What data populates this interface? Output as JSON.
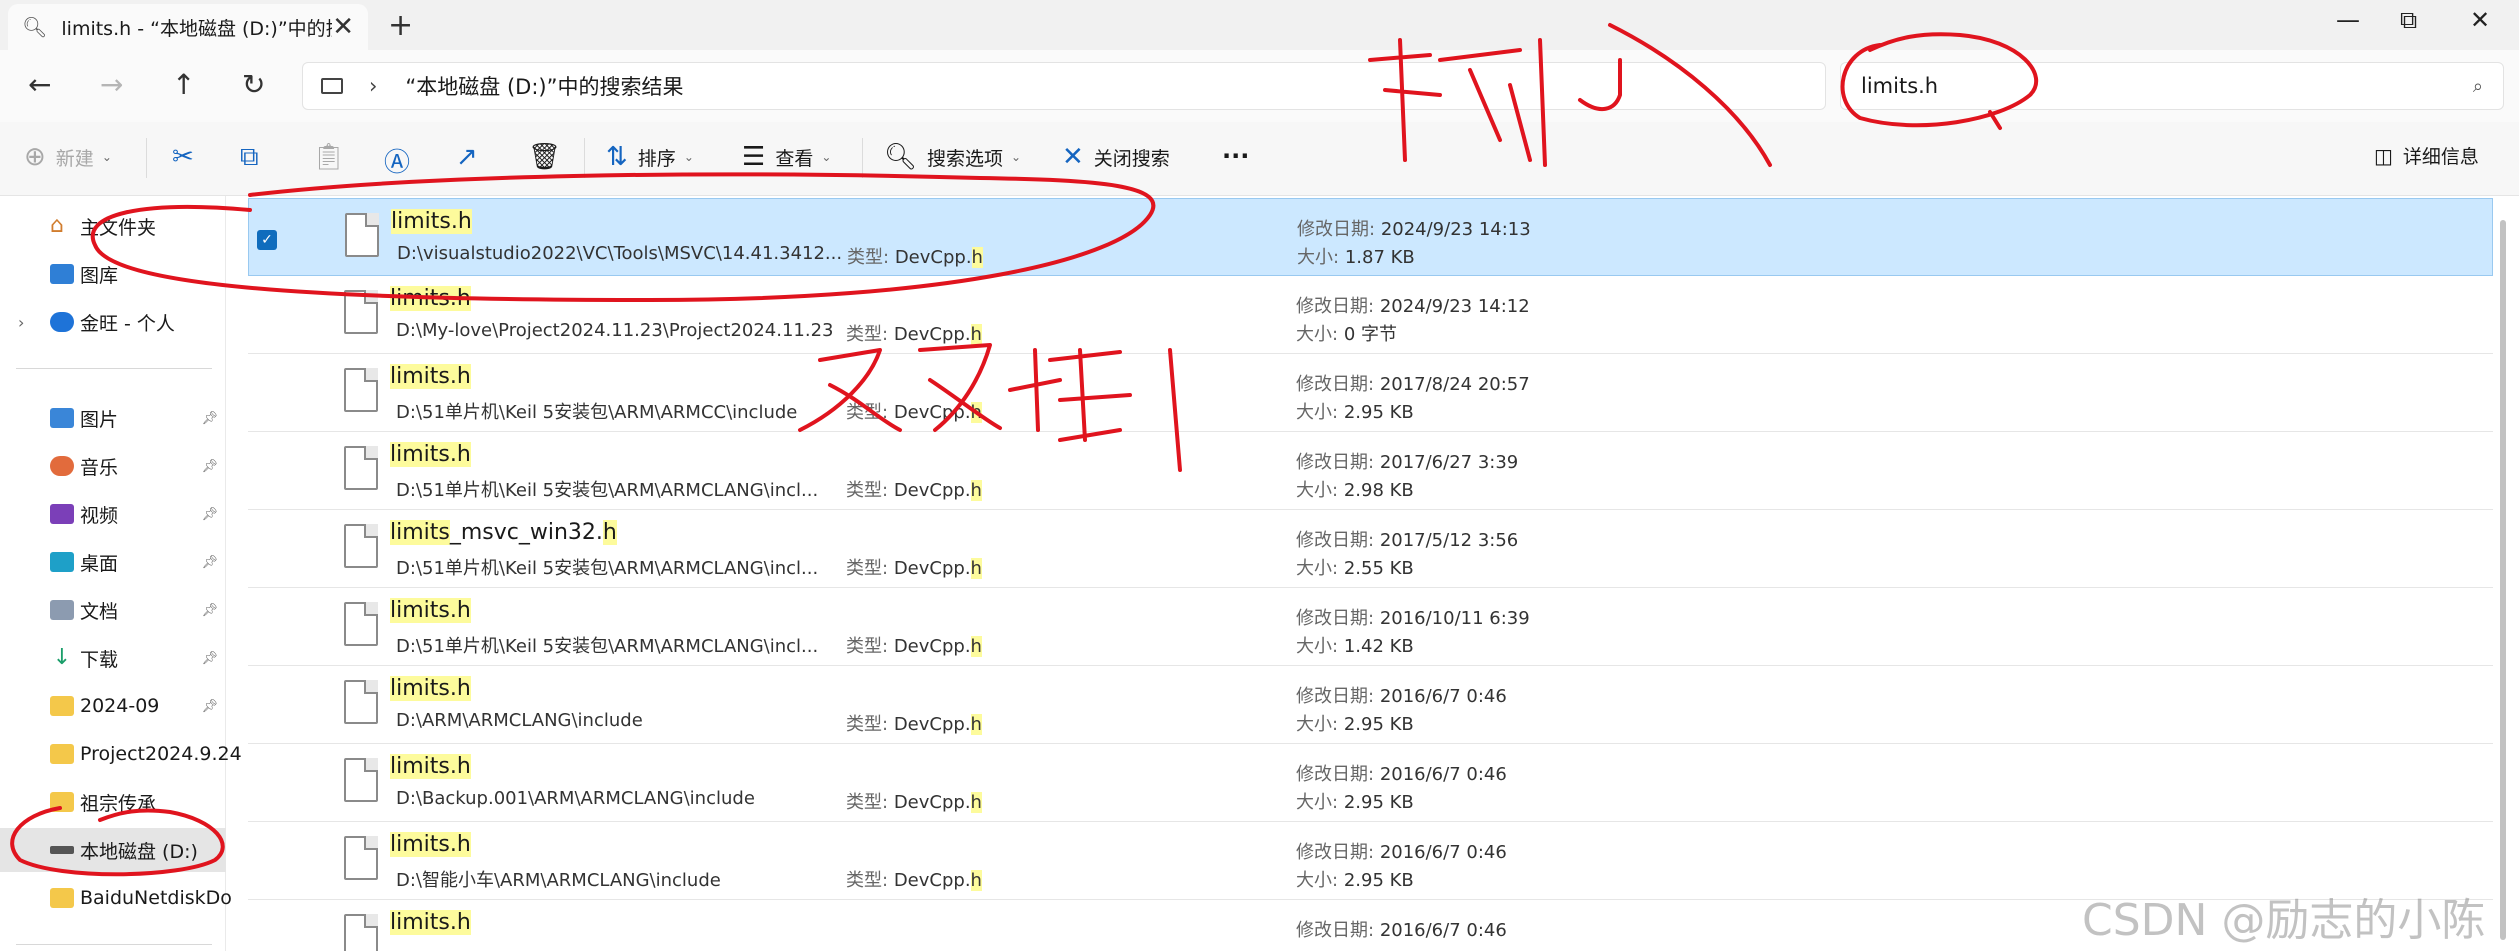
{
  "window": {
    "tab_title": "limits.h - “本地磁盘 (D:)”中的搜",
    "tab_close": "✕",
    "new_tab": "+",
    "minimize": "—",
    "maximize": "⧉",
    "close": "✕"
  },
  "address": {
    "breadcrumb": "“本地磁盘 (D:)”中的搜索结果",
    "search_value": "limits.h"
  },
  "toolbar": {
    "new_label": "新建",
    "sort_label": "排序",
    "view_label": "查看",
    "search_options_label": "搜索选项",
    "close_search_label": "关闭搜索",
    "more_label": "···",
    "details_label": "详细信息"
  },
  "sidebar": {
    "items": [
      {
        "label": "主文件夹"
      },
      {
        "label": "图库"
      },
      {
        "label": "金旺 - 个人"
      },
      {
        "label": "图片"
      },
      {
        "label": "音乐"
      },
      {
        "label": "视频"
      },
      {
        "label": "桌面"
      },
      {
        "label": "文档"
      },
      {
        "label": "下载"
      },
      {
        "label": "2024-09"
      },
      {
        "label": "Project2024.9.24"
      },
      {
        "label": "祖宗传承"
      },
      {
        "label": "本地磁盘 (D:)"
      },
      {
        "label": "BaiduNetdiskDo"
      }
    ]
  },
  "labels": {
    "type": "类型:",
    "modified": "修改日期:",
    "size": "大小:"
  },
  "files": [
    {
      "name_hl": "limits.h",
      "name_rest": "",
      "path": "D:\\visualstudio2022\\VC\\Tools\\MSVC\\14.41.3412...",
      "type_base": "DevCpp.",
      "type_hl": "h",
      "date": "2024/9/23 14:13",
      "size": "1.87 KB"
    },
    {
      "name_hl": "limits.h",
      "name_rest": "",
      "path": "D:\\My-love\\Project2024.11.23\\Project2024.11.23",
      "type_base": "DevCpp.",
      "type_hl": "h",
      "date": "2024/9/23 14:12",
      "size": "0 字节"
    },
    {
      "name_hl": "limits.h",
      "name_rest": "",
      "path": "D:\\51单片机\\Keil 5安装包\\ARM\\ARMCC\\include",
      "type_base": "DevCpp.",
      "type_hl": "h",
      "date": "2017/8/24 20:57",
      "size": "2.95 KB"
    },
    {
      "name_hl": "limits.h",
      "name_rest": "",
      "path": "D:\\51单片机\\Keil 5安装包\\ARM\\ARMCLANG\\incl...",
      "type_base": "DevCpp.",
      "type_hl": "h",
      "date": "2017/6/27 3:39",
      "size": "2.98 KB"
    },
    {
      "name_hl": "limits",
      "name_rest": "_msvc_win32.",
      "name_hl2": "h",
      "path": "D:\\51单片机\\Keil 5安装包\\ARM\\ARMCLANG\\incl...",
      "type_base": "DevCpp.",
      "type_hl": "h",
      "date": "2017/5/12 3:56",
      "size": "2.55 KB"
    },
    {
      "name_hl": "limits.h",
      "name_rest": "",
      "path": "D:\\51单片机\\Keil 5安装包\\ARM\\ARMCLANG\\incl...",
      "type_base": "DevCpp.",
      "type_hl": "h",
      "date": "2016/10/11 6:39",
      "size": "1.42 KB"
    },
    {
      "name_hl": "limits.h",
      "name_rest": "",
      "path": "D:\\ARM\\ARMCLANG\\include",
      "type_base": "DevCpp.",
      "type_hl": "h",
      "date": "2016/6/7 0:46",
      "size": "2.95 KB"
    },
    {
      "name_hl": "limits.h",
      "name_rest": "",
      "path": "D:\\Backup.001\\ARM\\ARMCLANG\\include",
      "type_base": "DevCpp.",
      "type_hl": "h",
      "date": "2016/6/7 0:46",
      "size": "2.95 KB"
    },
    {
      "name_hl": "limits.h",
      "name_rest": "",
      "path": "D:\\智能小车\\ARM\\ARMCLANG\\include",
      "type_base": "DevCpp.",
      "type_hl": "h",
      "date": "2016/6/7 0:46",
      "size": "2.95 KB"
    },
    {
      "name_hl": "limits.h",
      "name_rest": "",
      "path": "",
      "type_base": "",
      "type_hl": "",
      "date": "2016/6/7 0:46",
      "size": ""
    }
  ],
  "watermark": "CSDN @励志的小陈",
  "annotation_color": "#e0141e"
}
